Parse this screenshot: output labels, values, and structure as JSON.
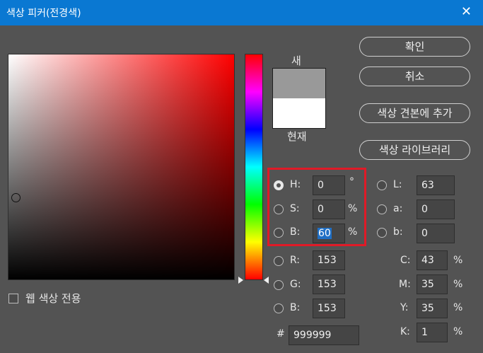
{
  "titlebar": {
    "title": "색상 피커(전경색)",
    "close_glyph": "✕"
  },
  "preview": {
    "new_label": "새",
    "current_label": "현재",
    "new_color": "#999999",
    "current_color": "#ffffff"
  },
  "buttons": {
    "ok": "확인",
    "cancel": "취소",
    "add_to_swatches": "색상 견본에 추가",
    "color_libraries": "색상 라이브러리"
  },
  "hsb": {
    "h_label": "H:",
    "h_value": "0",
    "h_unit": "°",
    "s_label": "S:",
    "s_value": "0",
    "s_unit": "%",
    "b_label": "B:",
    "b_value": "60",
    "b_unit": "%"
  },
  "rgb": {
    "r_label": "R:",
    "r_value": "153",
    "g_label": "G:",
    "g_value": "153",
    "b_label": "B:",
    "b_value": "153"
  },
  "lab": {
    "l_label": "L:",
    "l_value": "63",
    "a_label": "a:",
    "a_value": "0",
    "b_label": "b:",
    "b_value": "0"
  },
  "cmyk": {
    "c_label": "C:",
    "c_value": "43",
    "m_label": "M:",
    "m_value": "35",
    "y_label": "Y:",
    "y_value": "35",
    "k_label": "K:",
    "k_value": "1",
    "unit": "%"
  },
  "hex": {
    "label": "#",
    "value": "999999"
  },
  "web_colors_only": {
    "label": "웹 색상 전용",
    "checked": false
  },
  "selected_mode": "H",
  "highlight_color": "#e01a27"
}
